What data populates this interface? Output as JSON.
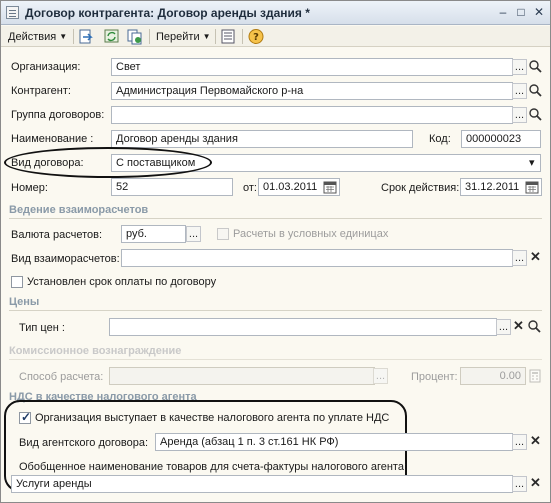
{
  "window": {
    "title": "Договор контрагента: Договор аренды здания *",
    "controls": [
      "–",
      "□",
      "✕"
    ]
  },
  "toolbar": {
    "actions_label": "Действия",
    "goto_label": "Перейти",
    "help_label": "?"
  },
  "form": {
    "organization": {
      "label": "Организация:",
      "value": "Свет"
    },
    "counterparty": {
      "label": "Контрагент:",
      "value": "Администрация Первомайского р-на"
    },
    "contract_group": {
      "label": "Группа договоров:",
      "value": ""
    },
    "name": {
      "label": "Наименование :",
      "value": "Договор аренды здания"
    },
    "code": {
      "label": "Код:",
      "value": "000000023"
    },
    "contract_type": {
      "label": "Вид договора:",
      "value": "С поставщиком"
    },
    "number": {
      "label": "Номер:",
      "value": "52"
    },
    "date_from": {
      "label": "от:",
      "value": "01.03.2011"
    },
    "valid_until": {
      "label": "Срок действия:",
      "value": "31.12.2011"
    }
  },
  "settlements": {
    "section_title": "Ведение взаиморасчетов",
    "currency": {
      "label": "Валюта расчетов:",
      "value": "руб."
    },
    "conventional_units": {
      "label": "Расчеты в условных единицах",
      "checked": false
    },
    "settlement_type": {
      "label": "Вид взаиморасчетов:",
      "value": ""
    },
    "payment_term": {
      "label": "Установлен срок оплаты по договору",
      "checked": false
    }
  },
  "prices": {
    "section_title": "Цены",
    "price_type": {
      "label": "Тип цен :",
      "value": ""
    }
  },
  "commission": {
    "section_title": "Комиссионное вознаграждение",
    "calc_method": {
      "label": "Способ расчета:",
      "value": ""
    },
    "percent": {
      "label": "Процент:",
      "value": "0.00"
    }
  },
  "vat_agent": {
    "section_title": "НДС в качестве налогового агента",
    "is_agent": {
      "label": "Организация выступает в качестве налогового агента по уплате НДС",
      "checked": true
    },
    "agent_contract_type": {
      "label": "Вид агентского договора:",
      "value": "Аренда (абзац 1 п. 3 ст.161 НК РФ)"
    },
    "goods_name": {
      "label": "Обобщенное наименование товаров для счета-фактуры налогового агента:",
      "value": "Услуги аренды"
    }
  },
  "glyphs": {
    "select": "...",
    "clear": "✕",
    "dropdown": "▾"
  },
  "icons": [
    "doc-icon",
    "save-icon",
    "refresh-icon",
    "copy-icon",
    "list-icon",
    "help-icon",
    "calendar-icon",
    "magnifier-icon"
  ]
}
